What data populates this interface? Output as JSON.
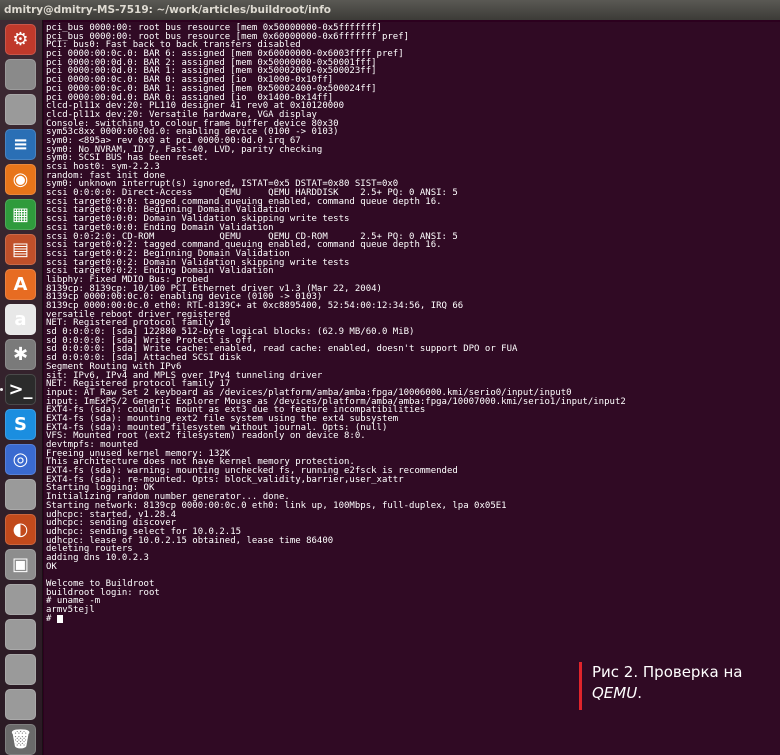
{
  "window": {
    "title": "dmitry@dmitry-MS-7519: ~/work/articles/buildroot/info"
  },
  "launcher": {
    "items": [
      {
        "name": "system-settings-icon",
        "glyph": "⚙",
        "color": "#c0392b"
      },
      {
        "name": "files-icon",
        "glyph": "",
        "color": "#8a8a8a"
      },
      {
        "name": "drive-icon",
        "glyph": "",
        "color": "#9a9a9a"
      },
      {
        "name": "writer-icon",
        "glyph": "≡",
        "color": "#2a6fb5"
      },
      {
        "name": "firefox-icon",
        "glyph": "◉",
        "color": "#e8751a"
      },
      {
        "name": "calc-icon",
        "glyph": "▦",
        "color": "#2f9b3c"
      },
      {
        "name": "impress-icon",
        "glyph": "▤",
        "color": "#c0502a"
      },
      {
        "name": "software-center-icon",
        "glyph": "A",
        "color": "#e76c22"
      },
      {
        "name": "amazon-icon",
        "glyph": "a",
        "color": "#e8e8e8"
      },
      {
        "name": "settings-tools-icon",
        "glyph": "✱",
        "color": "#7a7a7a"
      },
      {
        "name": "terminal-icon",
        "glyph": ">_",
        "color": "#2b2b2b"
      },
      {
        "name": "skype-icon",
        "glyph": "S",
        "color": "#1b8ee0"
      },
      {
        "name": "chromium-icon",
        "glyph": "◎",
        "color": "#3a6ad0"
      },
      {
        "name": "drive-icon-2",
        "glyph": "",
        "color": "#9a9a9a"
      },
      {
        "name": "app-icon-orange",
        "glyph": "◐",
        "color": "#c24a1c"
      },
      {
        "name": "floppy-icon",
        "glyph": "▣",
        "color": "#8d8d8d"
      },
      {
        "name": "drive-icon-3",
        "glyph": "",
        "color": "#9a9a9a"
      },
      {
        "name": "drive-icon-4",
        "glyph": "",
        "color": "#9a9a9a"
      },
      {
        "name": "drive-icon-5",
        "glyph": "",
        "color": "#9a9a9a"
      },
      {
        "name": "drive-icon-6",
        "glyph": "",
        "color": "#9a9a9a"
      },
      {
        "name": "trash-icon",
        "glyph": "🗑",
        "color": "#6a6a6a"
      }
    ]
  },
  "terminal": {
    "lines": [
      "pci_bus 0000:00: root bus resource [mem 0x50000000-0x5fffffff]",
      "pci_bus 0000:00: root bus resource [mem 0x60000000-0x6fffffff pref]",
      "PCI: bus0: Fast back to back transfers disabled",
      "pci 0000:00:0c.0: BAR 6: assigned [mem 0x60000000-0x6003ffff pref]",
      "pci 0000:00:0d.0: BAR 2: assigned [mem 0x50000000-0x50001fff]",
      "pci 0000:00:0d.0: BAR 1: assigned [mem 0x50002000-0x500023ff]",
      "pci 0000:00:0c.0: BAR 0: assigned [io  0x1000-0x10ff]",
      "pci 0000:00:0c.0: BAR 1: assigned [mem 0x50002400-0x500024ff]",
      "pci 0000:00:0d.0: BAR 0: assigned [io  0x1400-0x14ff]",
      "clcd-pl11x dev:20: PL110 designer 41 rev0 at 0x10120000",
      "clcd-pl11x dev:20: Versatile hardware, VGA display",
      "Console: switching to colour frame buffer device 80x30",
      "sym53c8xx 0000:00:0d.0: enabling device (0100 -> 0103)",
      "sym0: <895a> rev 0x0 at pci 0000:00:0d.0 irq 67",
      "sym0: No NVRAM, ID 7, Fast-40, LVD, parity checking",
      "sym0: SCSI BUS has been reset.",
      "scsi host0: sym-2.2.3",
      "random: fast init done",
      "sym0: unknown interrupt(s) ignored, ISTAT=0x5 DSTAT=0x80 SIST=0x0",
      "scsi 0:0:0:0: Direct-Access     QEMU     QEMU HARDDISK    2.5+ PQ: 0 ANSI: 5",
      "scsi target0:0:0: tagged command queuing enabled, command queue depth 16.",
      "scsi target0:0:0: Beginning Domain Validation",
      "scsi target0:0:0: Domain Validation skipping write tests",
      "scsi target0:0:0: Ending Domain Validation",
      "scsi 0:0:2:0: CD-ROM            QEMU     QEMU CD-ROM      2.5+ PQ: 0 ANSI: 5",
      "scsi target0:0:2: tagged command queuing enabled, command queue depth 16.",
      "scsi target0:0:2: Beginning Domain Validation",
      "scsi target0:0:2: Domain Validation skipping write tests",
      "scsi target0:0:2: Ending Domain Validation",
      "libphy: Fixed MDIO Bus: probed",
      "8139cp: 8139cp: 10/100 PCI Ethernet driver v1.3 (Mar 22, 2004)",
      "8139cp 0000:00:0c.0: enabling device (0100 -> 0103)",
      "8139cp 0000:00:0c.0 eth0: RTL-8139C+ at 0xc8895400, 52:54:00:12:34:56, IRQ 66",
      "versatile reboot driver registered",
      "NET: Registered protocol family 10",
      "sd 0:0:0:0: [sda] 122880 512-byte logical blocks: (62.9 MB/60.0 MiB)",
      "sd 0:0:0:0: [sda] Write Protect is off",
      "sd 0:0:0:0: [sda] Write cache: enabled, read cache: enabled, doesn't support DPO or FUA",
      "sd 0:0:0:0: [sda] Attached SCSI disk",
      "Segment Routing with IPv6",
      "sit: IPv6, IPv4 and MPLS over IPv4 tunneling driver",
      "NET: Registered protocol family 17",
      "input: AT Raw Set 2 keyboard as /devices/platform/amba/amba:fpga/10006000.kmi/serio0/input/input0",
      "input: ImExPS/2 Generic Explorer Mouse as /devices/platform/amba/amba:fpga/10007000.kmi/serio1/input/input2",
      "EXT4-fs (sda): couldn't mount as ext3 due to feature incompatibilities",
      "EXT4-fs (sda): mounting ext2 file system using the ext4 subsystem",
      "EXT4-fs (sda): mounted filesystem without journal. Opts: (null)",
      "VFS: Mounted root (ext2 filesystem) readonly on device 8:0.",
      "devtmpfs: mounted",
      "Freeing unused kernel memory: 132K",
      "This architecture does not have kernel memory protection.",
      "EXT4-fs (sda): warning: mounting unchecked fs, running e2fsck is recommended",
      "EXT4-fs (sda): re-mounted. Opts: block_validity,barrier,user_xattr",
      "Starting logging: OK",
      "Initializing random number generator... done.",
      "Starting network: 8139cp 0000:00:0c.0 eth0: link up, 100Mbps, full-duplex, lpa 0x05E1",
      "udhcpc: started, v1.28.4",
      "udhcpc: sending discover",
      "udhcpc: sending select for 10.0.2.15",
      "udhcpc: lease of 10.0.2.15 obtained, lease time 86400",
      "deleting routers",
      "adding dns 10.0.2.3",
      "OK",
      "",
      "Welcome to Buildroot",
      "buildroot login: root",
      "# uname -m",
      "armv5tejl",
      "# "
    ]
  },
  "caption": {
    "text_before": "Рис 2. Проверка на ",
    "emph": "QEMU",
    "text_after": "."
  }
}
